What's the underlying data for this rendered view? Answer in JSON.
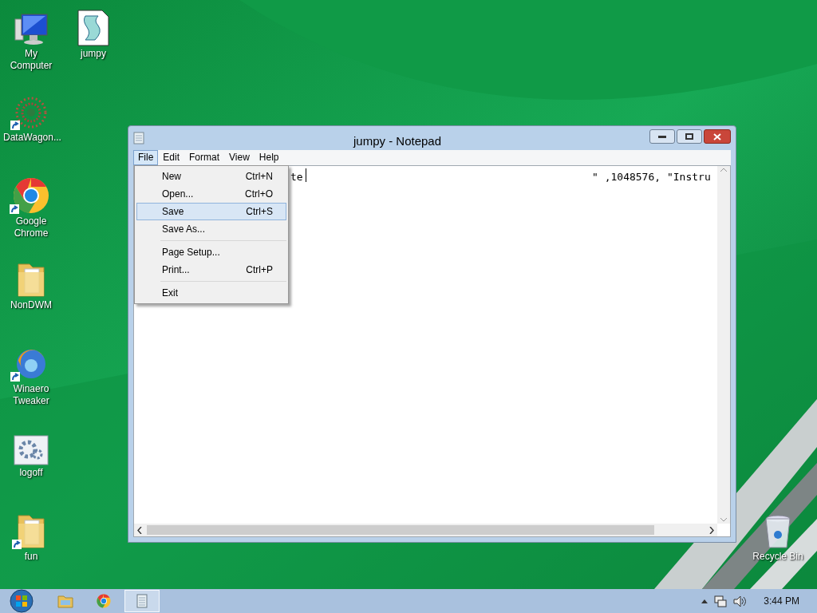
{
  "desktop_icons": [
    {
      "label": "My Computer",
      "kind": "computer",
      "shortcut": false
    },
    {
      "label": "jumpy",
      "kind": "script",
      "shortcut": false
    },
    {
      "label": "DataWagon...",
      "kind": "dots",
      "shortcut": true
    },
    {
      "label": "Google Chrome",
      "kind": "chrome",
      "shortcut": true
    },
    {
      "label": "NonDWM",
      "kind": "folder",
      "shortcut": false
    },
    {
      "label": "Winaero Tweaker",
      "kind": "swirl",
      "shortcut": true
    },
    {
      "label": "logoff",
      "kind": "gear",
      "shortcut": false
    },
    {
      "label": "fun",
      "kind": "folder",
      "shortcut": true
    },
    {
      "label": "Recycle Bin",
      "kind": "bin",
      "shortcut": false
    }
  ],
  "window": {
    "title": "jumpy - Notepad",
    "menu_bar": [
      {
        "label": "File",
        "selected": true
      },
      {
        "label": "Edit",
        "selected": false
      },
      {
        "label": "Format",
        "selected": false
      },
      {
        "label": "View",
        "selected": false
      },
      {
        "label": "Help",
        "selected": false
      }
    ],
    "editor": {
      "visible_text_left": "te",
      "visible_text_right": "\" ,1048576, \"Instru"
    },
    "file_menu": [
      {
        "kind": "item",
        "label": "New",
        "shortcut": "Ctrl+N",
        "selected": false
      },
      {
        "kind": "item",
        "label": "Open...",
        "shortcut": "Ctrl+O",
        "selected": false
      },
      {
        "kind": "item",
        "label": "Save",
        "shortcut": "Ctrl+S",
        "selected": true
      },
      {
        "kind": "item",
        "label": "Save As...",
        "selected": false
      },
      {
        "kind": "separator"
      },
      {
        "kind": "item",
        "label": "Page Setup...",
        "selected": false
      },
      {
        "kind": "item",
        "label": "Print...",
        "shortcut": "Ctrl+P",
        "selected": false
      },
      {
        "kind": "separator"
      },
      {
        "kind": "item",
        "label": "Exit",
        "selected": false
      }
    ]
  },
  "taskbar": {
    "pinned": [
      {
        "kind": "explorer",
        "active": false
      },
      {
        "kind": "chrome",
        "active": false
      },
      {
        "kind": "notepad",
        "active": true
      }
    ],
    "clock": "3:44 PM"
  }
}
